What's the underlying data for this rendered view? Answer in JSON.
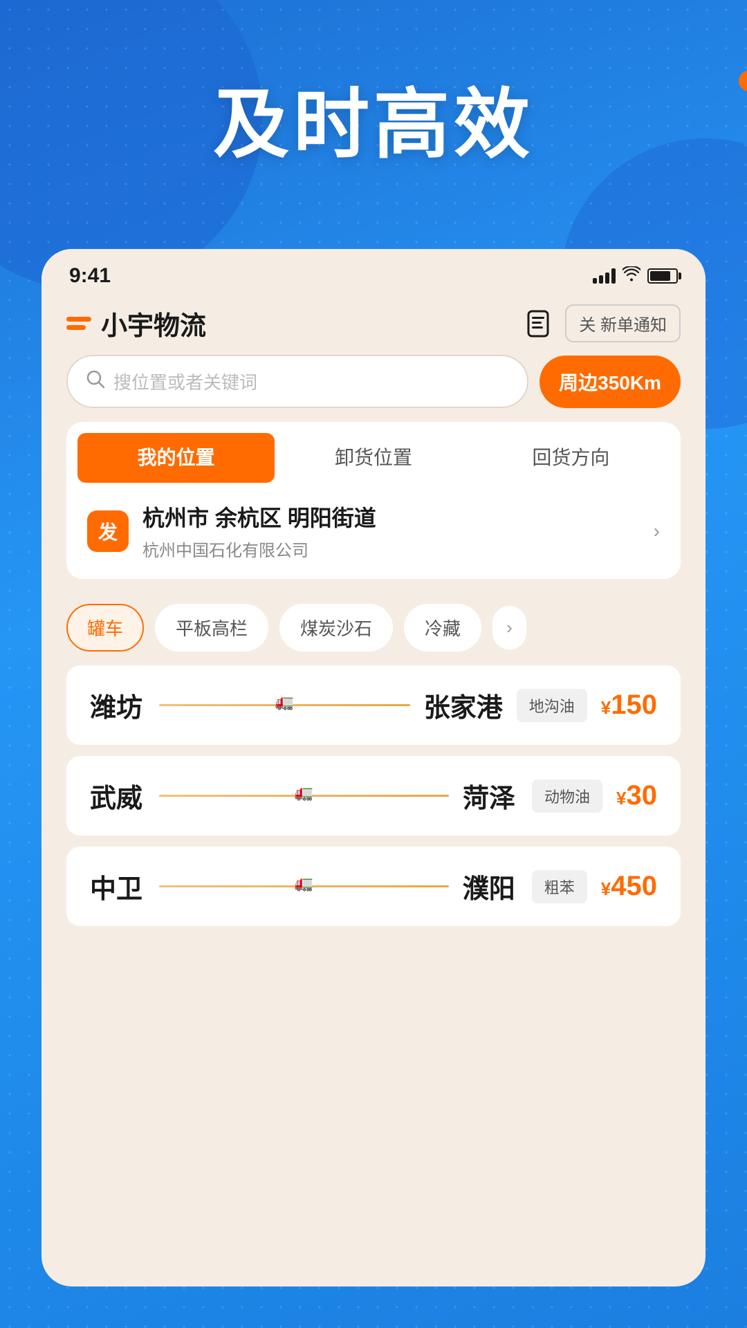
{
  "hero": {
    "title": "及时高效",
    "dot_color": "#ff6b00"
  },
  "status_bar": {
    "time": "9:41"
  },
  "header": {
    "logo_text": "小宇物流",
    "notification_label": "关 新单通知"
  },
  "search": {
    "placeholder": "搜位置或者关键词",
    "nearby_btn": "周边350Km"
  },
  "tabs": {
    "items": [
      {
        "label": "我的位置",
        "active": true
      },
      {
        "label": "卸货位置",
        "active": false
      },
      {
        "label": "回货方向",
        "active": false
      }
    ]
  },
  "location": {
    "badge": "发",
    "main": "杭州市 余杭区 明阳街道",
    "sub": "杭州中国石化有限公司"
  },
  "categories": [
    {
      "label": "罐车",
      "active": true
    },
    {
      "label": "平板高栏",
      "active": false
    },
    {
      "label": "煤炭沙石",
      "active": false
    },
    {
      "label": "冷藏",
      "active": false
    }
  ],
  "routes": [
    {
      "from": "潍坊",
      "to": "张家港",
      "tag": "地沟油",
      "price": "150"
    },
    {
      "from": "武威",
      "to": "菏泽",
      "tag": "动物油",
      "price": "30"
    },
    {
      "from": "中卫",
      "to": "濮阳",
      "tag": "粗苯",
      "price": "450"
    }
  ]
}
